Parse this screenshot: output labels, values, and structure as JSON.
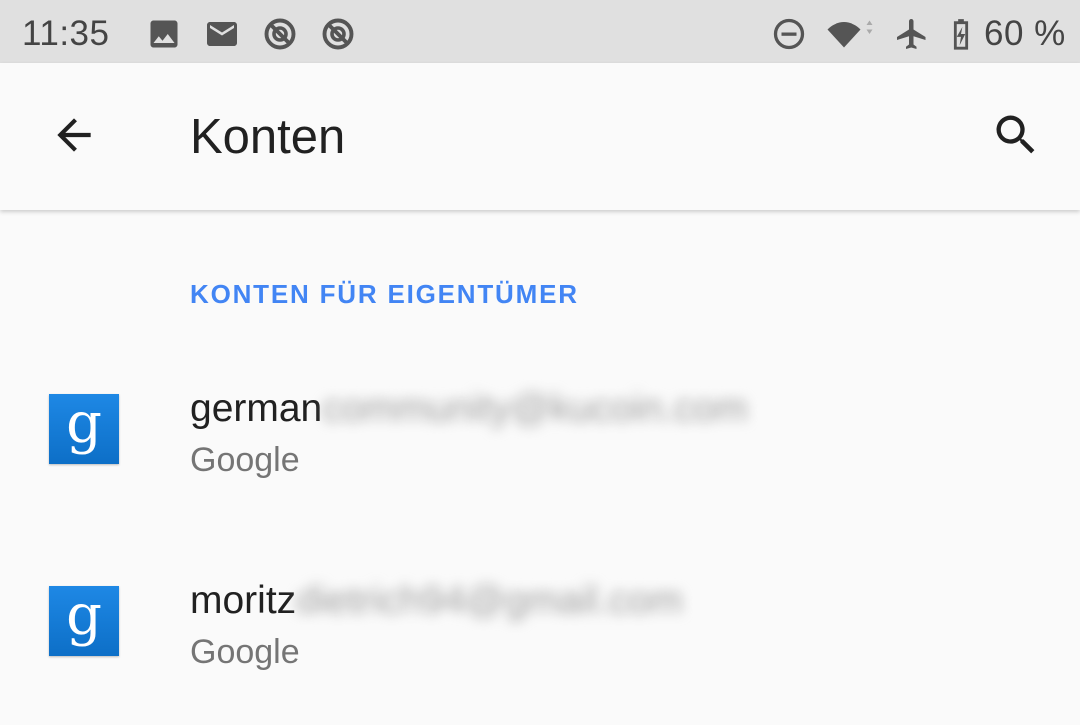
{
  "status_bar": {
    "time": "11:35",
    "battery_level": "60 %",
    "icons_left": [
      "image-icon",
      "mail-icon",
      "sync-disabled-icon",
      "sync-disabled-icon"
    ],
    "icons_right": [
      "do-not-disturb-icon",
      "wifi-icon",
      "airplane-icon",
      "battery-charging-icon"
    ]
  },
  "app_bar": {
    "title": "Konten",
    "back_icon": "arrow-back-icon",
    "search_icon": "search-icon"
  },
  "section": {
    "header": "KONTEN FÜR EIGENTÜMER"
  },
  "accounts": [
    {
      "name_visible": "german",
      "name_blurred": "community@kucoin.com",
      "type": "Google",
      "icon_letter": "g"
    },
    {
      "name_visible": "moritz",
      "name_blurred": "dietrich94@gmail.com",
      "type": "Google",
      "icon_letter": "g"
    }
  ],
  "colors": {
    "accent": "#4285f4",
    "status_bar_bg": "#e0e0e0",
    "background": "#fafafa",
    "google_icon_bg": "#1a7ed4"
  }
}
